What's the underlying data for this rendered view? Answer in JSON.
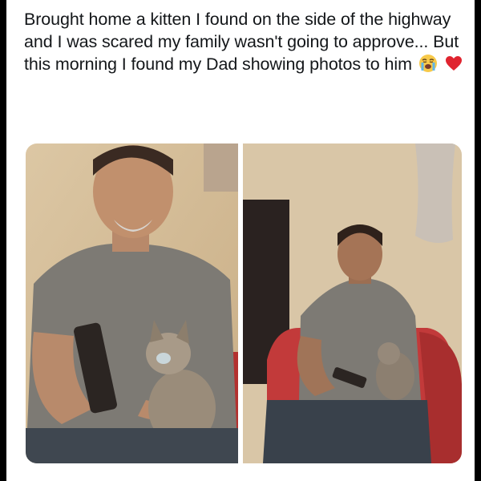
{
  "post": {
    "text": "Brought home a kitten I found on the side of the highway and I was scared my family wasn't going to approve... But this morning I found my Dad showing photos to him",
    "emojis": [
      "loudly-crying-face-emoji",
      "red-heart-emoji"
    ]
  },
  "photos": [
    {
      "name": "photo-left"
    },
    {
      "name": "photo-right"
    }
  ],
  "colors": {
    "card_background": "#ffffff",
    "text": "#14171a",
    "wall": "#d8c3a0",
    "shirt": "#7d7a74",
    "chair": "#c23a3a"
  }
}
